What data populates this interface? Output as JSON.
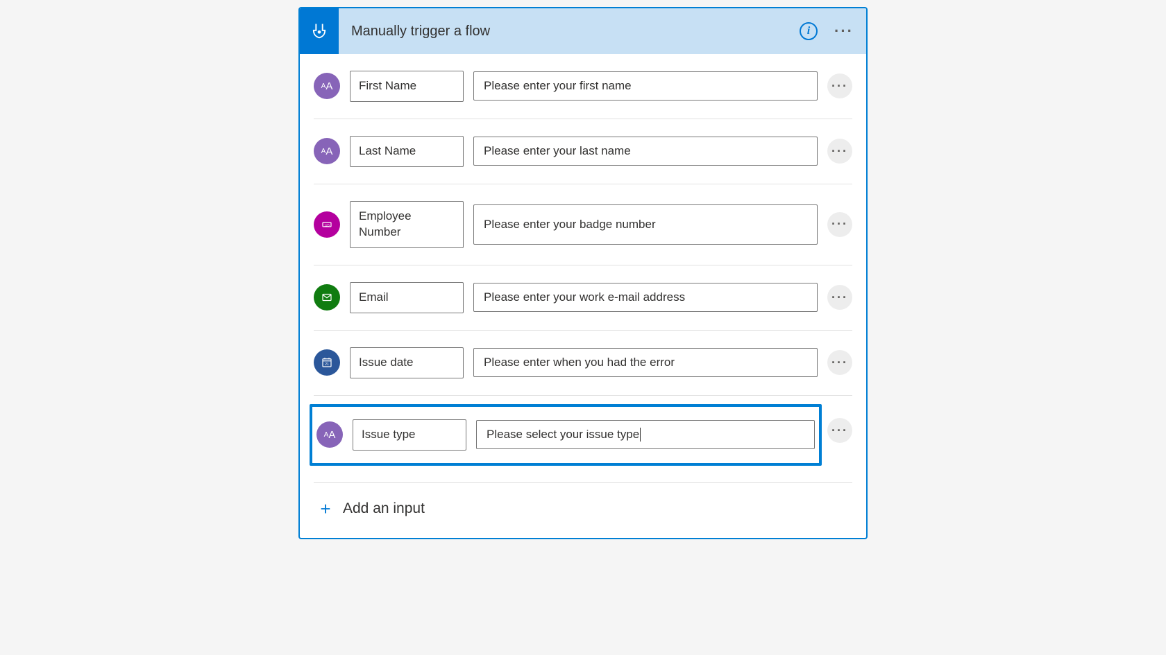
{
  "header": {
    "title": "Manually trigger a flow"
  },
  "inputs": [
    {
      "icon": "text",
      "name": "First Name",
      "placeholder": "Please enter your first name"
    },
    {
      "icon": "text",
      "name": "Last Name",
      "placeholder": "Please enter your last name"
    },
    {
      "icon": "number",
      "name": "Employee Number",
      "placeholder": "Please enter your badge number"
    },
    {
      "icon": "email",
      "name": "Email",
      "placeholder": "Please enter your work e-mail address"
    },
    {
      "icon": "date",
      "name": "Issue date",
      "placeholder": "Please enter when you had the error"
    },
    {
      "icon": "text",
      "name": "Issue type",
      "placeholder": "Please select your issue type",
      "highlighted": true,
      "active": true
    }
  ],
  "addInput": {
    "label": "Add an input"
  }
}
